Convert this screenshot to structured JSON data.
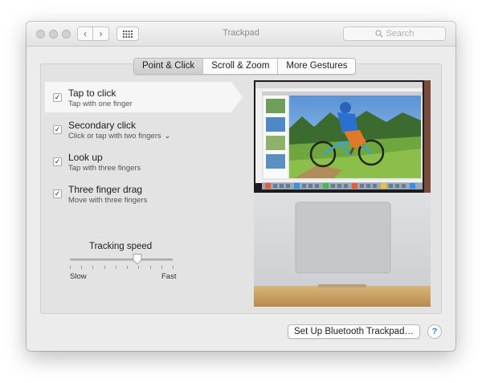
{
  "window": {
    "title": "Trackpad"
  },
  "toolbar": {
    "back_label": "‹",
    "forward_label": "›",
    "search_placeholder": "Search"
  },
  "tabs": [
    {
      "label": "Point & Click",
      "active": true
    },
    {
      "label": "Scroll & Zoom",
      "active": false
    },
    {
      "label": "More Gestures",
      "active": false
    }
  ],
  "options": [
    {
      "title": "Tap to click",
      "subtitle": "Tap with one finger",
      "checked": true,
      "selected": true
    },
    {
      "title": "Secondary click",
      "subtitle": "Click or tap with two fingers",
      "checked": true,
      "selected": false,
      "has_dropdown": true
    },
    {
      "title": "Look up",
      "subtitle": "Tap with three fingers",
      "checked": true,
      "selected": false
    },
    {
      "title": "Three finger drag",
      "subtitle": "Move with three fingers",
      "checked": true,
      "selected": false
    }
  ],
  "tracking": {
    "label": "Tracking speed",
    "min_label": "Slow",
    "max_label": "Fast",
    "value_fraction": 0.66
  },
  "footer": {
    "bluetooth_button": "Set Up Bluetooth Trackpad…",
    "help_label": "?"
  },
  "colors": {
    "selection": "#f6f6f6",
    "pane": "#e3e3e3",
    "window": "#ececec",
    "help_accent": "#3a7de0"
  }
}
